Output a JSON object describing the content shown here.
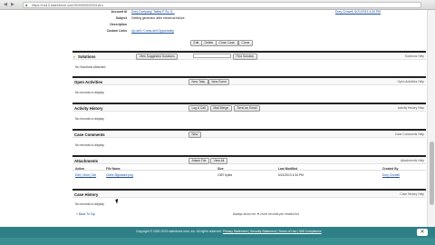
{
  "browser": {
    "url": "https://na13.salesforce.com/500000000001Arn",
    "back": "◀",
    "forward": "▶"
  },
  "detail": {
    "rows": [
      {
        "label": "Account Id",
        "value": "Dory Company, Tabbs F Ss, 5..."
      },
      {
        "label": "Subject",
        "value": "Getting generator after electrical failure"
      },
      {
        "label": "Description",
        "value": ""
      },
      {
        "label": "Custom Links",
        "value": "Up-sell / Cross-sell Opportunity"
      }
    ],
    "right_label": "Assigned to",
    "right_value": "Dory Crowell, 6/21/2013 4:34 PM",
    "buttons": [
      "Edit",
      "Delete",
      "Close Case",
      "Clone"
    ]
  },
  "sections": [
    {
      "title": "Solutions",
      "help": "Solutions Help",
      "buttons": [
        "View Suggested Solutions",
        "Find Solution"
      ],
      "empty": "No Solutions Attached"
    },
    {
      "title": "Open Activities",
      "help": "Open Activities Help",
      "buttons": [
        "New Task",
        "New Event"
      ],
      "empty": "No records to display"
    },
    {
      "title": "Activity History",
      "help": "Activity History Help",
      "buttons": [
        "Log A Call",
        "Mail Merge",
        "Send an Email"
      ],
      "empty": "No records to display"
    },
    {
      "title": "Case Comments",
      "help": "Case Comments Help",
      "buttons": [
        "New"
      ],
      "empty": "No records to display"
    },
    {
      "title": "Attachments",
      "help": "Attachments Help",
      "buttons": [
        "Attach File",
        "View All"
      ],
      "empty": ""
    },
    {
      "title": "Case History",
      "help": "Case History Help",
      "buttons": [],
      "empty": "No records to display"
    }
  ],
  "attachments": {
    "columns": [
      "Action",
      "File Name",
      "Size",
      "Last Modified",
      "Created By"
    ],
    "row": {
      "action": "Edit | View | Del",
      "file": "Client Signature.png",
      "size": "1357 bytes",
      "modified": "6/21/2013 4:34 PM",
      "created_by": "Dory Crowell"
    }
  },
  "footer": {
    "back": "« Back To Top",
    "show_more": "Always show me ▼ more records per related list"
  },
  "bottom": {
    "copyright": "Copyright © 2000-2013 salesforce.com, inc. All rights reserved.",
    "links": "Privacy Statement | Security Statement | Terms of Use | 508 Compliance",
    "close": "✕"
  }
}
